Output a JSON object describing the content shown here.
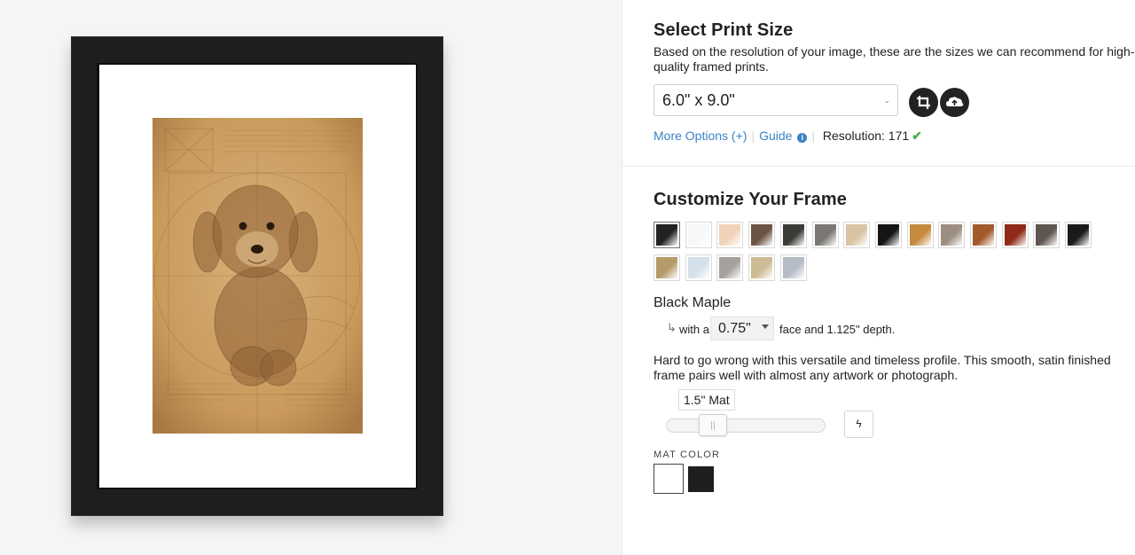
{
  "preview": {
    "frame_color": "#1e1e1e",
    "mat_color": "#ffffff",
    "artwork": "sepia Da Vinci style sketch of a curly-haired poodle puppy inside a Vitruvian circle"
  },
  "print_size": {
    "title": "Select Print Size",
    "description": "Based on the resolution of your image, these are the sizes we can recommend for high-quality framed prints.",
    "description_line1": "Based on the resolution of your image, these are the sizes we can recommend for high-",
    "description_line2": "quality framed prints.",
    "selected_size": "6.0\" x 9.0\"",
    "crop_icon": "crop-icon",
    "upload_icon": "cloud-upload-icon",
    "more_options": "More Options (+)",
    "guide": "Guide",
    "resolution_label": "Resolution:",
    "resolution_value": "171",
    "resolution_ok_color": "#4cae4c"
  },
  "frame": {
    "title": "Customize Your Frame",
    "selected_name": "Black Maple",
    "with_label": "with a",
    "face_value": "0.75\"",
    "face_suffix": "face and 1.125\" depth.",
    "description": "Hard to go wrong with this versatile and timeless profile. This smooth, satin finished frame pairs well with almost any artwork or photograph.",
    "swatches_row1": [
      {
        "name": "black-maple",
        "color": "#222222"
      },
      {
        "name": "white",
        "color": "#f7f7f7"
      },
      {
        "name": "natural-maple",
        "color": "#f0d2b8"
      },
      {
        "name": "walnut",
        "color": "#6b5444"
      },
      {
        "name": "charcoal",
        "color": "#3a3a36"
      },
      {
        "name": "gray-driftwood",
        "color": "#7a7774"
      },
      {
        "name": "light-oak",
        "color": "#d8c3a3"
      },
      {
        "name": "black-gold",
        "color": "#151515"
      },
      {
        "name": "gold",
        "color": "#c58a3c"
      },
      {
        "name": "silver-wood",
        "color": "#9c8f82"
      },
      {
        "name": "cherry",
        "color": "#a25a2d"
      },
      {
        "name": "red-mahogany",
        "color": "#8f2a18"
      },
      {
        "name": "dark-gray-wood",
        "color": "#5f5551"
      },
      {
        "name": "black-marble",
        "color": "#1a1a1a"
      }
    ],
    "swatches_row2": [
      {
        "name": "bamboo",
        "color": "#b59a6a"
      },
      {
        "name": "frost",
        "color": "#d4e0ea"
      },
      {
        "name": "pewter",
        "color": "#a5a29e"
      },
      {
        "name": "champagne",
        "color": "#cdbb94"
      },
      {
        "name": "steel",
        "color": "#b5bcc5"
      }
    ],
    "mat_label": "1.5\" Mat",
    "mat_size_fraction": 0.25,
    "bolt_icon": "bolt-icon",
    "mat_color_label": "MAT COLOR",
    "mat_colors": [
      "#ffffff",
      "#1f1f1f"
    ]
  }
}
